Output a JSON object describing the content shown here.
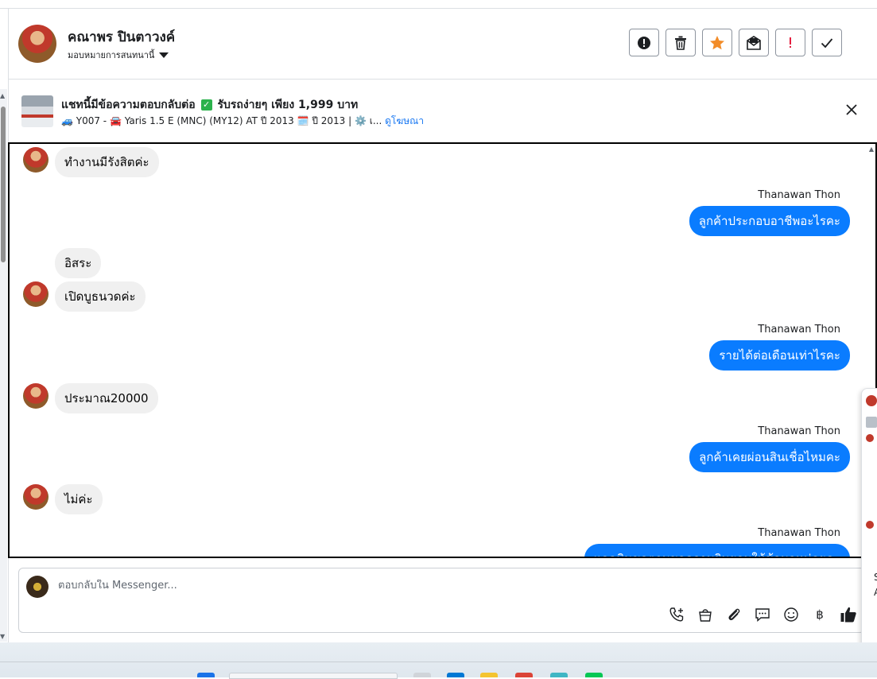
{
  "header": {
    "contact_name": "คณาพร ปินตาวงค์",
    "assign_label": "มอบหมายการสนทนานี้",
    "actions": [
      {
        "name": "mark-spam-button",
        "icon": "exclamation-circle-icon"
      },
      {
        "name": "delete-button",
        "icon": "trash-icon"
      },
      {
        "name": "star-button",
        "icon": "star-icon",
        "color": "#f28c28"
      },
      {
        "name": "mark-unread-button",
        "icon": "envelope-icon"
      },
      {
        "name": "follow-up-button",
        "icon": "exclamation-icon",
        "color": "#e41e3f"
      },
      {
        "name": "mark-done-button",
        "icon": "check-icon"
      }
    ]
  },
  "ad": {
    "title_part1": "แชทนี้มีข้อความตอบกลับต่อ",
    "check": "✓",
    "title_part2": "รับรถง่ายๆ เพียง 1,999 บาท",
    "subtitle": "🚙 Y007 - 🚘 Yaris 1.5 E (MNC) (MY12) AT ปี 2013 🗓️ ปี 2013 | ⚙️ เ...",
    "link": "ดูโฆษณา"
  },
  "messages": {
    "m1": "ทำงานมีรังสิตค่ะ",
    "s1": "Thanawan Thon",
    "o1": "ลูกค้าประกอบอาชีพอะไรคะ",
    "m2": "อิสระ",
    "m3": "เปิดบูธนวดค่ะ",
    "s2": "Thanawan Thon",
    "o2": "รายได้ต่อเดือนเท่าไรคะ",
    "m4": "ประมาณ20000",
    "s3": "Thanawan Thon",
    "o3": "ลูกค้าเคยผ่อนสินเชื่อไหมคะ",
    "m5": "ไม่ค่ะ",
    "s4": "Thanawan Thon",
    "o4": "แอดมินขอตามขอความยินยอมให้ข้อมูลหน่อยคะ"
  },
  "composer": {
    "placeholder": "ตอบกลับใน Messenger...",
    "tools": [
      "phone-plus-icon",
      "shopping-bag-icon",
      "paperclip-icon",
      "chat-bubbles-icon",
      "emoji-icon",
      "baht-icon",
      "thumbs-up-icon"
    ],
    "baht_symbol": "฿"
  },
  "side_popup": {
    "letters": [
      "S",
      "A"
    ]
  },
  "colors": {
    "outgoing_bubble": "#0a7cff",
    "incoming_bubble": "#f0f0f0",
    "link": "#1877f2"
  }
}
